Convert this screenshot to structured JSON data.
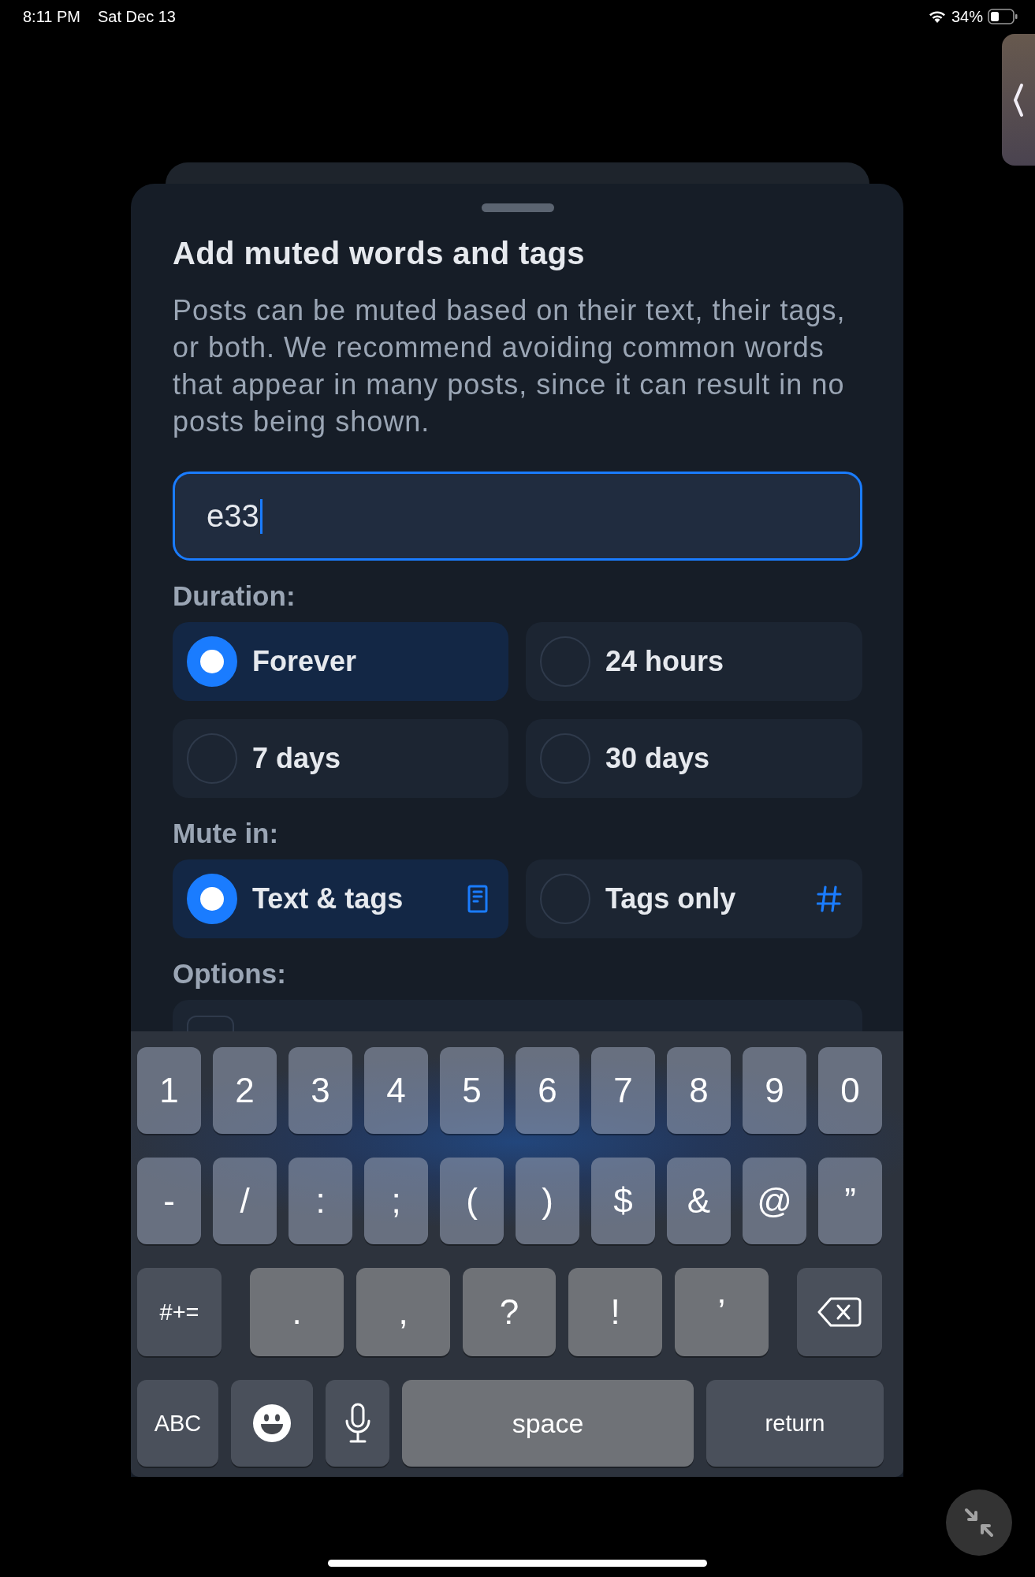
{
  "status_bar": {
    "time": "8:11 PM",
    "date": "Sat Dec 13",
    "battery": "34%"
  },
  "sheet": {
    "title": "Add muted words and tags",
    "description": "Posts can be muted based on their text, their tags, or both. We recommend avoiding common words that appear in many posts, since it can result in no posts being shown.",
    "input": {
      "value": "e33",
      "focused": true
    },
    "duration": {
      "label": "Duration:",
      "options": [
        {
          "label": "Forever",
          "selected": true
        },
        {
          "label": "24 hours",
          "selected": false
        },
        {
          "label": "7 days",
          "selected": false
        },
        {
          "label": "30 days",
          "selected": false
        }
      ]
    },
    "mute_in": {
      "label": "Mute in:",
      "options": [
        {
          "label": "Text & tags",
          "selected": true,
          "kind": "text"
        },
        {
          "label": "Tags only",
          "selected": false,
          "kind": "tags"
        }
      ]
    },
    "options": {
      "label": "Options:",
      "items": [
        {
          "checked": false
        }
      ]
    }
  },
  "keyboard": {
    "rows": [
      {
        "keys": [
          {
            "kind": "char",
            "label": "1"
          },
          {
            "kind": "char",
            "label": "2"
          },
          {
            "kind": "char",
            "label": "3"
          },
          {
            "kind": "char",
            "label": "4"
          },
          {
            "kind": "char",
            "label": "5"
          },
          {
            "kind": "char",
            "label": "6"
          },
          {
            "kind": "char",
            "label": "7"
          },
          {
            "kind": "char",
            "label": "8"
          },
          {
            "kind": "char",
            "label": "9"
          },
          {
            "kind": "char",
            "label": "0"
          }
        ]
      },
      {
        "keys": [
          {
            "kind": "char",
            "label": "-"
          },
          {
            "kind": "char",
            "label": "/"
          },
          {
            "kind": "char",
            "label": ":"
          },
          {
            "kind": "char",
            "label": ";"
          },
          {
            "kind": "char",
            "label": "("
          },
          {
            "kind": "char",
            "label": ")"
          },
          {
            "kind": "char",
            "label": "$"
          },
          {
            "kind": "char",
            "label": "&"
          },
          {
            "kind": "char",
            "label": "@"
          },
          {
            "kind": "char",
            "label": "”"
          }
        ]
      },
      {
        "keys": [
          {
            "kind": "function",
            "label": "#+="
          },
          {
            "kind": "char",
            "label": "."
          },
          {
            "kind": "char",
            "label": ","
          },
          {
            "kind": "char",
            "label": "?"
          },
          {
            "kind": "char",
            "label": "!"
          },
          {
            "kind": "char",
            "label": "’"
          },
          {
            "kind": "delete"
          }
        ]
      },
      {
        "keys": [
          {
            "kind": "function",
            "label": "ABC"
          },
          {
            "kind": "emoji"
          },
          {
            "kind": "mic"
          },
          {
            "kind": "space",
            "label": "space"
          },
          {
            "kind": "function",
            "label": "return"
          }
        ]
      }
    ]
  }
}
